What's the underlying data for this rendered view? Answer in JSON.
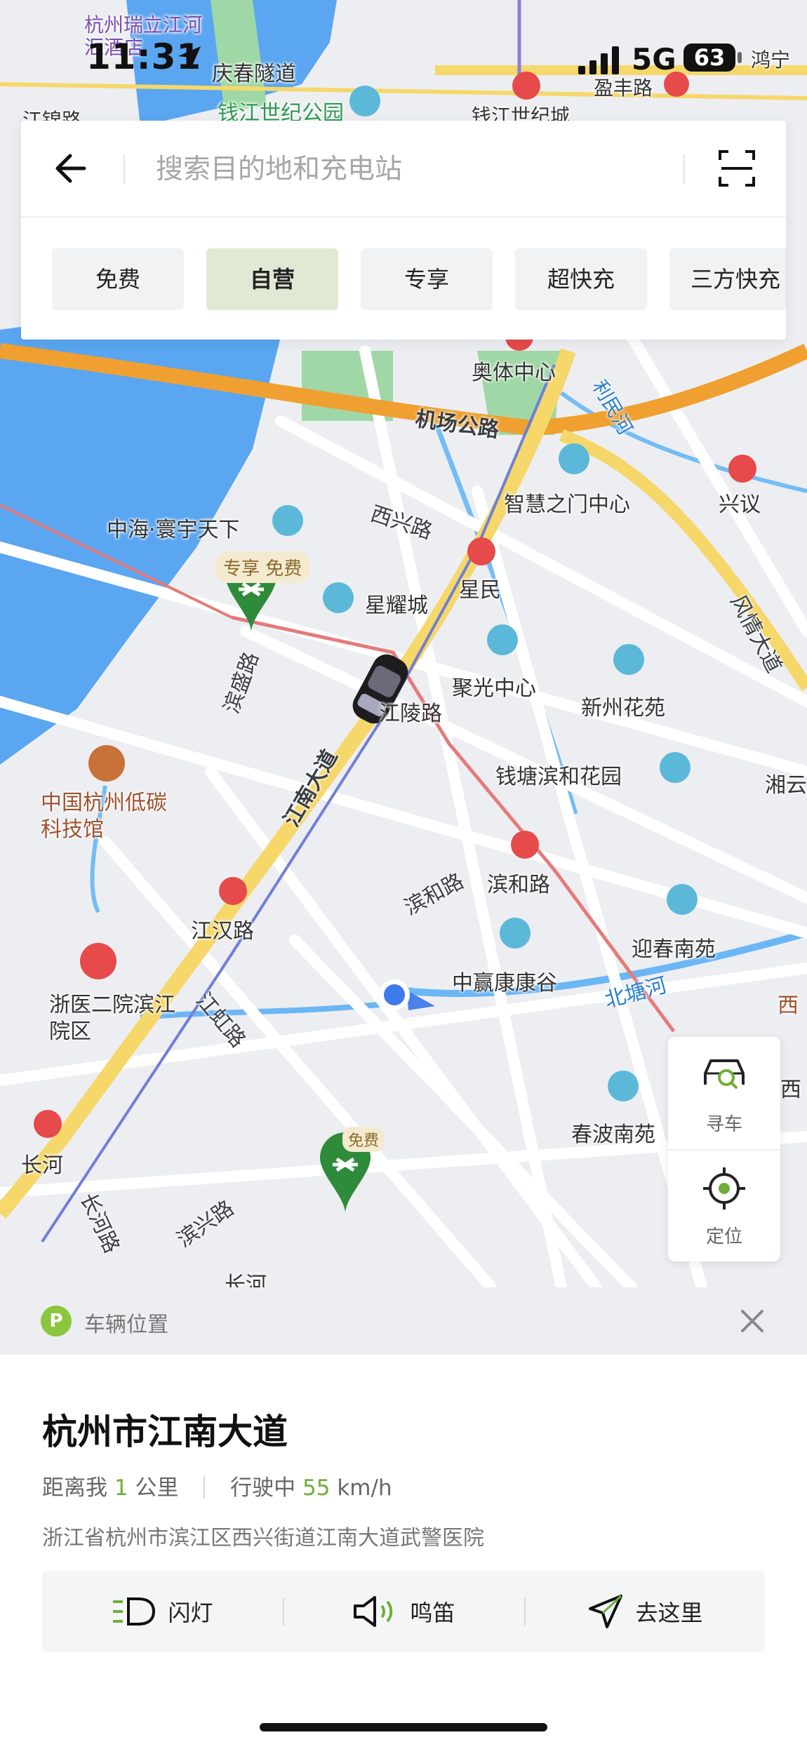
{
  "status_bar": {
    "time": "11:31",
    "network": "5G",
    "battery": "63"
  },
  "search": {
    "placeholder": "搜索目的地和充电站"
  },
  "filters": [
    {
      "label": "免费"
    },
    {
      "label": "自营"
    },
    {
      "label": "专享"
    },
    {
      "label": "超快充"
    },
    {
      "label": "三方快充"
    }
  ],
  "map": {
    "labels": {
      "top_left_hotel": "杭州瑞立江河汇酒店",
      "qingchun_tunnel": "庆春隧道",
      "qianjiang_park": "钱江世纪公园",
      "yingfeng_road": "盈丰路",
      "qianjiang_city": "钱江世纪城",
      "hongpu": "鸿宁",
      "jiangjin_road": "江锦路",
      "sports_center": "奥体中心",
      "airport_road": "机场公路",
      "lishenghe": "利民河",
      "wisdom_gate": "智慧之门中心",
      "xingyi": "兴议",
      "xixing_road": "西兴路",
      "zhonghai": "中海·寰宇天下",
      "xingyao_city": "星耀城",
      "xingmin": "星民",
      "fengqing_avenue": "风情大道",
      "binsheng_road": "滨盛路",
      "juguang_center": "聚光中心",
      "xinzhou_garden": "新州花苑",
      "jiangling_road": "江陵路",
      "jiangnan_avenue": "江南大道",
      "hangzhou_museum": "中国杭州低碳科技馆",
      "qiantang_binhe": "钱塘滨和花园",
      "xiangyun": "湘云",
      "binhe_road_1": "滨和路",
      "binhe_road_2": "滨和路",
      "jianghan_road": "江汉路",
      "yingchun_garden": "迎春南苑",
      "zhongying": "中赢康康谷",
      "beitang_river": "北塘河",
      "hospital": "浙医二院滨江院区",
      "jianghong_road": "江虹路",
      "xi_1": "西",
      "xi_2": "西",
      "changhe": "长河",
      "changhe_road": "长河路",
      "binxing_road": "滨兴路",
      "chunbo": "春波南苑",
      "chang_bottom": "长河"
    },
    "station_badges": {
      "station_a": "专享 免费",
      "station_b": "免费"
    }
  },
  "tools": {
    "find_car": "寻车",
    "locate": "定位"
  },
  "vehicle_bar": {
    "badge": "P",
    "title": "车辆位置"
  },
  "panel": {
    "title": "杭州市江南大道",
    "distance_prefix": "距离我",
    "distance_value": "1",
    "distance_unit": "公里",
    "driving_prefix": "行驶中",
    "speed_value": "55",
    "speed_unit": "km/h",
    "address": "浙江省杭州市滨江区西兴街道江南大道武警医院"
  },
  "actions": {
    "flash": "闪灯",
    "horn": "鸣笛",
    "go": "去这里"
  },
  "colors": {
    "accent_green": "#6fae3a",
    "water": "#5aa6f0",
    "road_yellow": "#f6d76a",
    "road_orange": "#f0a030",
    "station_green": "#2e8b3a"
  }
}
